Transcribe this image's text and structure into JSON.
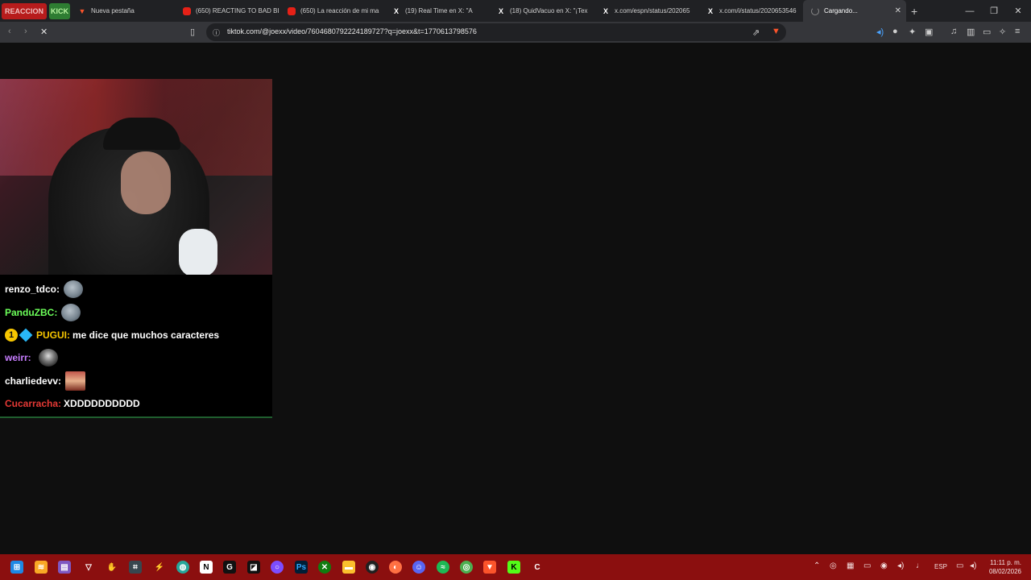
{
  "bookmarks": [
    {
      "label": "REACCION",
      "color": "#b71c1c"
    },
    {
      "label": "KICK",
      "color": "#2e7d32"
    }
  ],
  "tabs": [
    {
      "label": "Nueva pestaña",
      "icon": "brave-icon"
    },
    {
      "label": "(650) REACTING TO BAD BI",
      "icon": "youtube-icon"
    },
    {
      "label": "(650) La reacción de mi ma",
      "icon": "youtube-icon"
    },
    {
      "label": "(19) Real Time en X: \"A",
      "icon": "x-icon"
    },
    {
      "label": "(18) QuidVacuo en X: \"¡Tex",
      "icon": "x-icon"
    },
    {
      "label": "x.com/espn/status/202065",
      "icon": "x-icon"
    },
    {
      "label": "x.com/i/status/2020653546",
      "icon": "x-icon"
    },
    {
      "label": "Cargando...",
      "icon": "loading-icon",
      "active": true
    }
  ],
  "address": {
    "url": "tiktok.com/@joexx/video/7604680792224189727?q=joexx&t=1770613798576"
  },
  "chat": [
    {
      "user": "renzo_tdco:",
      "user_color": "#ffffff",
      "message": "",
      "emote": "face-emote"
    },
    {
      "user": "PanduZBC:",
      "user_color": "#6cff5a",
      "message": "",
      "emote": "face-emote"
    },
    {
      "user": "PUGUI:",
      "user_color": "#f7c600",
      "message": "me dice que muchos caracteres",
      "emote": "",
      "badges": [
        "1",
        "cube"
      ]
    },
    {
      "user": "weirr:",
      "user_color": "#c77dff",
      "message": "",
      "emote": "dark-emote"
    },
    {
      "user": "charliedevv:",
      "user_color": "#ffffff",
      "message": "",
      "emote": "red-emote"
    },
    {
      "user": "Cucarracha:",
      "user_color": "#e53935",
      "message": "XDDDDDDDDDD",
      "emote": ""
    }
  ],
  "taskbar": {
    "time": "11:11 p. m.",
    "date": "08/02/2026",
    "lang": "ESP",
    "background": "#8b0f0f"
  }
}
